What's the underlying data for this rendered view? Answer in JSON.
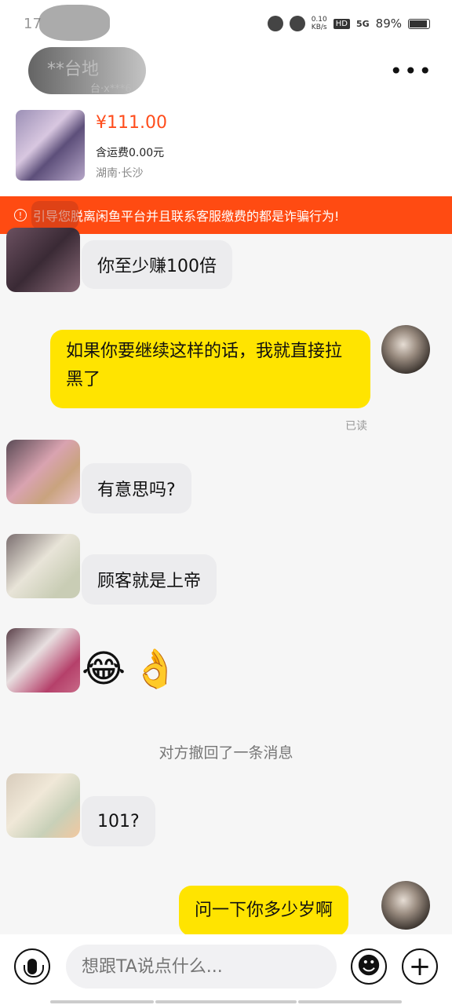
{
  "status_bar": {
    "time": "17",
    "net_speed_top": "0.10",
    "net_speed_bottom": "KB/s",
    "hd": "HD",
    "signal": "5G",
    "battery": "89%"
  },
  "header": {
    "seller_name": "**台地",
    "seller_sub": "台·x***6",
    "more_label": "•••"
  },
  "product": {
    "price": "¥111.00",
    "shipping": "含运费0.00元",
    "location": "湖南·长沙"
  },
  "warning": {
    "icon": "!",
    "text": "引导您脱离闲鱼平台并且联系客服缴费的都是诈骗行为!"
  },
  "messages": {
    "m1": "你至少赚100倍",
    "m2": "如果你要继续这样的话，我就直接拉黑了",
    "m2_status": "已读",
    "m3": "有意思吗?",
    "m4": "顾客就是上帝",
    "m5_emoji_1": "😂",
    "m5_emoji_2": "👌",
    "system": "对方撤回了一条消息",
    "m6": "101?",
    "m7": "问一下你多少岁啊"
  },
  "input": {
    "placeholder": "想跟TA说点什么..."
  },
  "icons": {
    "mic": "microphone-icon",
    "emoji": "smiley-icon",
    "plus": "plus-icon"
  },
  "colors": {
    "accent_yellow": "#ffe400",
    "warning_red": "#ff4b12",
    "price_orange": "#ff4d1c"
  }
}
